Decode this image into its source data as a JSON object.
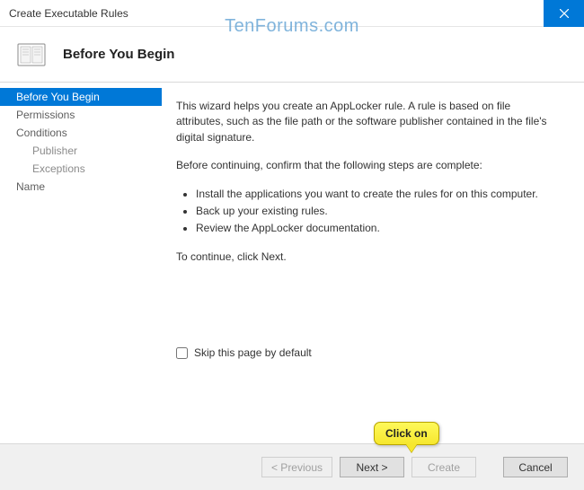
{
  "window": {
    "title": "Create Executable Rules"
  },
  "watermark": "TenForums.com",
  "header": {
    "title": "Before You Begin"
  },
  "sidebar": {
    "items": [
      {
        "label": "Before You Begin",
        "selected": true,
        "sub": false
      },
      {
        "label": "Permissions",
        "selected": false,
        "sub": false
      },
      {
        "label": "Conditions",
        "selected": false,
        "sub": false
      },
      {
        "label": "Publisher",
        "selected": false,
        "sub": true
      },
      {
        "label": "Exceptions",
        "selected": false,
        "sub": true
      },
      {
        "label": "Name",
        "selected": false,
        "sub": false
      }
    ]
  },
  "content": {
    "intro": "This wizard helps you create an AppLocker rule. A rule is based on file attributes, such as the file path or the software publisher contained in the file's digital signature.",
    "confirm": "Before continuing, confirm that the following steps are complete:",
    "bullets": [
      "Install the applications you want to create the rules for on this computer.",
      "Back up your existing rules.",
      "Review the AppLocker documentation."
    ],
    "continue": "To continue, click Next.",
    "skip_label": "Skip this page by default"
  },
  "footer": {
    "previous": "< Previous",
    "next": "Next >",
    "create": "Create",
    "cancel": "Cancel"
  },
  "callout": "Click on"
}
